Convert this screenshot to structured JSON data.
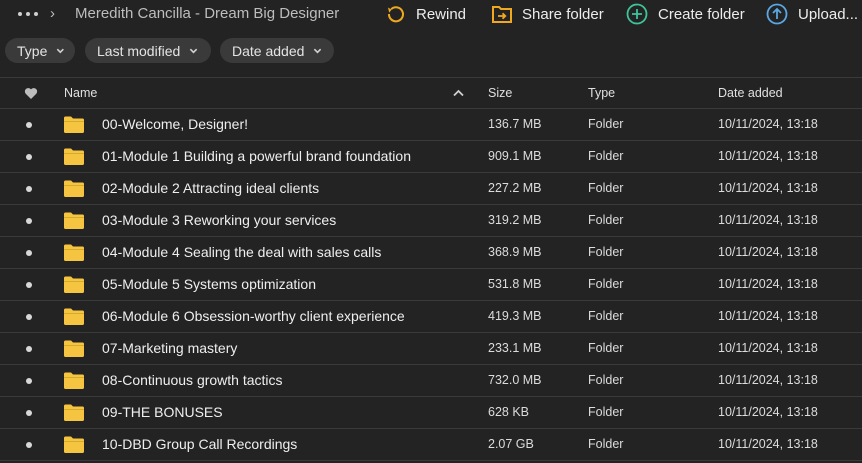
{
  "header": {
    "more_icon": "more-horizontal-icon",
    "breadcrumb_chevron": "›",
    "folder_title": "Meredith Cancilla - Dream Big Designer",
    "actions": {
      "rewind": "Rewind",
      "share_folder": "Share folder",
      "create_folder": "Create folder",
      "upload": "Upload..."
    }
  },
  "filters": {
    "type": "Type",
    "last_modified": "Last modified",
    "date_added": "Date added"
  },
  "table": {
    "columns": {
      "name": "Name",
      "size": "Size",
      "type": "Type",
      "date_added": "Date added"
    },
    "rows": [
      {
        "name": "00-Welcome, Designer!",
        "size": "136.7 MB",
        "type": "Folder",
        "date": "10/11/2024, 13:18"
      },
      {
        "name": "01-Module 1 Building a powerful brand foundation",
        "size": "909.1 MB",
        "type": "Folder",
        "date": "10/11/2024, 13:18"
      },
      {
        "name": "02-Module 2 Attracting ideal clients",
        "size": "227.2 MB",
        "type": "Folder",
        "date": "10/11/2024, 13:18"
      },
      {
        "name": "03-Module 3 Reworking your services",
        "size": "319.2 MB",
        "type": "Folder",
        "date": "10/11/2024, 13:18"
      },
      {
        "name": "04-Module 4 Sealing the deal with sales calls",
        "size": "368.9 MB",
        "type": "Folder",
        "date": "10/11/2024, 13:18"
      },
      {
        "name": "05-Module 5 Systems optimization",
        "size": "531.8 MB",
        "type": "Folder",
        "date": "10/11/2024, 13:18"
      },
      {
        "name": "06-Module 6 Obsession-worthy client experience",
        "size": "419.3 MB",
        "type": "Folder",
        "date": "10/11/2024, 13:18"
      },
      {
        "name": "07-Marketing mastery",
        "size": "233.1 MB",
        "type": "Folder",
        "date": "10/11/2024, 13:18"
      },
      {
        "name": "08-Continuous growth tactics",
        "size": "732.0 MB",
        "type": "Folder",
        "date": "10/11/2024, 13:18"
      },
      {
        "name": "09-THE BONUSES",
        "size": "628 KB",
        "type": "Folder",
        "date": "10/11/2024, 13:18"
      },
      {
        "name": "10-DBD Group Call Recordings",
        "size": "2.07 GB",
        "type": "Folder",
        "date": "10/11/2024, 13:18"
      }
    ]
  },
  "colors": {
    "background": "#232323",
    "chip": "#3a3a3a",
    "folder": "#f5c542",
    "rewind_icon": "#f0a91f",
    "share_icon": "#f0a91f",
    "create_icon": "#3ec39a",
    "upload_icon": "#5aa7e6"
  }
}
